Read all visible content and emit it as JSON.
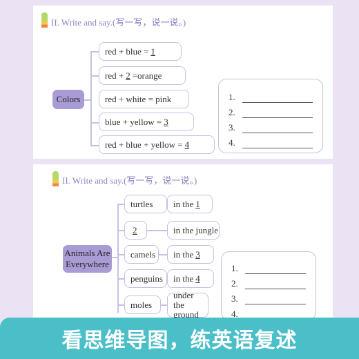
{
  "section1": {
    "title": "II. Write and say.(写一写，说一说。)",
    "hub": "Colors",
    "items": [
      {
        "pre": "red + blue = ",
        "blank": "1",
        "post": ""
      },
      {
        "pre": "red + ",
        "blank": "2",
        "post": " =orange"
      },
      {
        "pre": "red + white = pink",
        "blank": "",
        "post": ""
      },
      {
        "pre": "blue + yellow = ",
        "blank": "3",
        "post": ""
      },
      {
        "pre": "red + blue + yellow = ",
        "blank": "4",
        "post": ""
      }
    ],
    "answers": [
      "1.",
      "2.",
      "3.",
      "4."
    ]
  },
  "section2": {
    "title": "II. Write and say.(写一写，说一说。)",
    "hub": "Animals Are Everywhere",
    "animals": [
      {
        "name": "turtles",
        "blank": ""
      },
      {
        "name": "",
        "blank": "2"
      },
      {
        "name": "camels",
        "blank": ""
      },
      {
        "name": "penguins",
        "blank": ""
      },
      {
        "name": "moles",
        "blank": ""
      }
    ],
    "places": [
      {
        "pre": "in the ",
        "blank": "1"
      },
      {
        "pre": "in the jungle",
        "blank": ""
      },
      {
        "pre": "in the ",
        "blank": "3"
      },
      {
        "pre": "in the ",
        "blank": "4"
      },
      {
        "pre": "under the ground",
        "blank": ""
      }
    ],
    "answers": [
      "1.",
      "2.",
      "3.",
      "4."
    ]
  },
  "banner": "看思维导图，练英语复述",
  "colors": {
    "accent": "#a99bd3",
    "banner": "#4bbfc8",
    "background": "#ebe3f4"
  }
}
